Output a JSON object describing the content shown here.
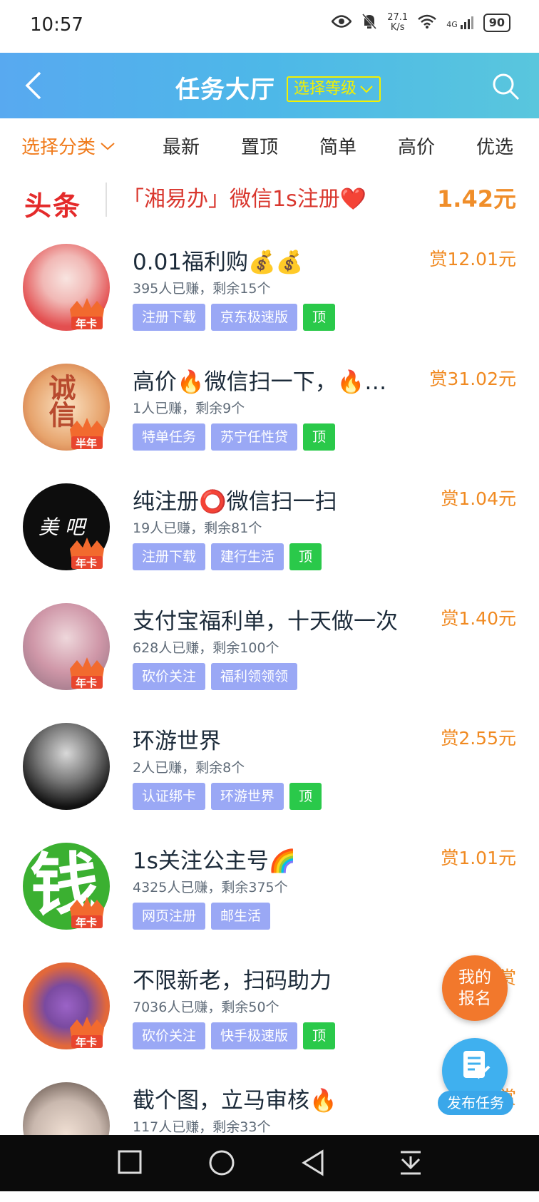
{
  "status": {
    "time": "10:57",
    "speed_value": "27.1",
    "speed_unit": "K/s",
    "network": "4G",
    "battery": "90"
  },
  "header": {
    "title": "任务大厅",
    "level_button": "选择等级"
  },
  "tabs": {
    "category": "选择分类",
    "items": [
      "最新",
      "置顶",
      "简单",
      "高价",
      "优选"
    ]
  },
  "headline": {
    "logo": "头条",
    "text": "「湘易办」微信1s注册❤️",
    "price": "1.42元"
  },
  "tasks": [
    {
      "title": "0.01福利购💰💰",
      "reward": "赏12.01元",
      "stats": "395人已赚，剩余15个",
      "tags": [
        "注册下载",
        "京东极速版"
      ],
      "top": "顶",
      "badge": "年卡",
      "avatar_color": "#e65a5a"
    },
    {
      "title": "高价🔥微信扫一下，🔥…",
      "reward": "赏31.02元",
      "stats": "1人已赚，剩余9个",
      "tags": [
        "特单任务",
        "苏宁任性贷"
      ],
      "top": "顶",
      "badge": "半年",
      "avatar_color": "#f3d2a8",
      "avatar_text": "诚信"
    },
    {
      "title": "纯注册⭕微信扫一扫",
      "reward": "赏1.04元",
      "stats": "19人已赚，剩余81个",
      "tags": [
        "注册下载",
        "建行生活"
      ],
      "top": "顶",
      "badge": "年卡",
      "avatar_color": "#0d0d0d",
      "avatar_text": "美 吧"
    },
    {
      "title": "支付宝福利单，十天做一次",
      "reward": "赏1.40元",
      "stats": "628人已赚，剩余100个",
      "tags": [
        "砍价关注",
        "福利领领领"
      ],
      "top": "",
      "badge": "年卡",
      "avatar_color": "#d7a6b6"
    },
    {
      "title": "环游世界",
      "reward": "赏2.55元",
      "stats": "2人已赚，剩余8个",
      "tags": [
        "认证绑卡",
        "环游世界"
      ],
      "top": "顶",
      "badge": "",
      "avatar_color": "#222222"
    },
    {
      "title": "1s关注公主号🌈",
      "reward": "赏1.01元",
      "stats": "4325人已赚，剩余375个",
      "tags": [
        "网页注册",
        "邮生活"
      ],
      "top": "",
      "badge": "年卡",
      "avatar_color": "#3bb031",
      "avatar_text": "钱"
    },
    {
      "title": "不限新老，扫码助力",
      "reward": "赏",
      "stats": "7036人已赚，剩余50个",
      "tags": [
        "砍价关注",
        "快手极速版"
      ],
      "top": "顶",
      "badge": "年卡",
      "avatar_color": "#e2683a"
    },
    {
      "title": "截个图，立马审核🔥",
      "reward": "赏",
      "stats": "117人已赚，剩余33个",
      "tags": [],
      "top": "",
      "badge": "",
      "avatar_color": "#c9b8ae"
    }
  ],
  "fab": {
    "register_line1": "我的",
    "register_line2": "报名",
    "publish": "发布任务"
  }
}
